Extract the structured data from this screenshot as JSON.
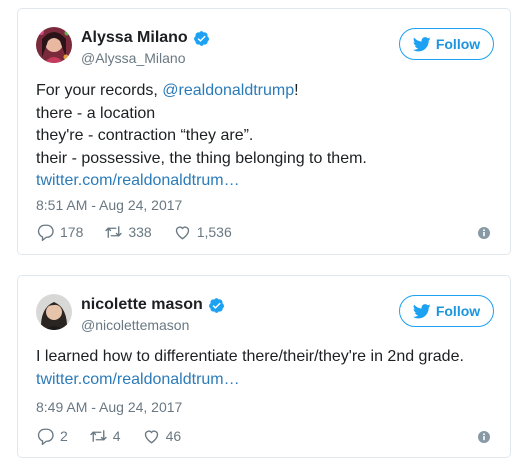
{
  "tweets": [
    {
      "display_name": "Alyssa Milano",
      "handle": "@Alyssa_Milano",
      "follow_label": "Follow",
      "text_lines": [
        {
          "pre": "For your records, ",
          "mention": "@realdonaldtrump",
          "post": "!"
        },
        "there - a location",
        "they're - contraction “they are”.",
        "their - possessive, the thing belonging to them."
      ],
      "link": "twitter.com/realdonaldtrum…",
      "timestamp": "8:51 AM - Aug 24, 2017",
      "replies": "178",
      "retweets": "338",
      "likes": "1,536",
      "icons": [
        "verified-icon",
        "twitter-bird-icon",
        "reply-icon",
        "retweet-icon",
        "like-icon",
        "info-icon"
      ]
    },
    {
      "display_name": "nicolette mason",
      "handle": "@nicolettemason",
      "follow_label": "Follow",
      "text_lines": [
        "I learned how to differentiate there/their/they're in 2nd grade."
      ],
      "link": "twitter.com/realdonaldtrum…",
      "timestamp": "8:49 AM - Aug 24, 2017",
      "replies": "2",
      "retweets": "4",
      "likes": "46",
      "icons": [
        "verified-icon",
        "twitter-bird-icon",
        "reply-icon",
        "retweet-icon",
        "like-icon",
        "info-icon"
      ]
    }
  ],
  "colors": {
    "brand_blue": "#1da1f2",
    "link_blue": "#2b7bb9",
    "text": "#1c2022",
    "muted": "#697882",
    "border": "#e1e8ed"
  }
}
